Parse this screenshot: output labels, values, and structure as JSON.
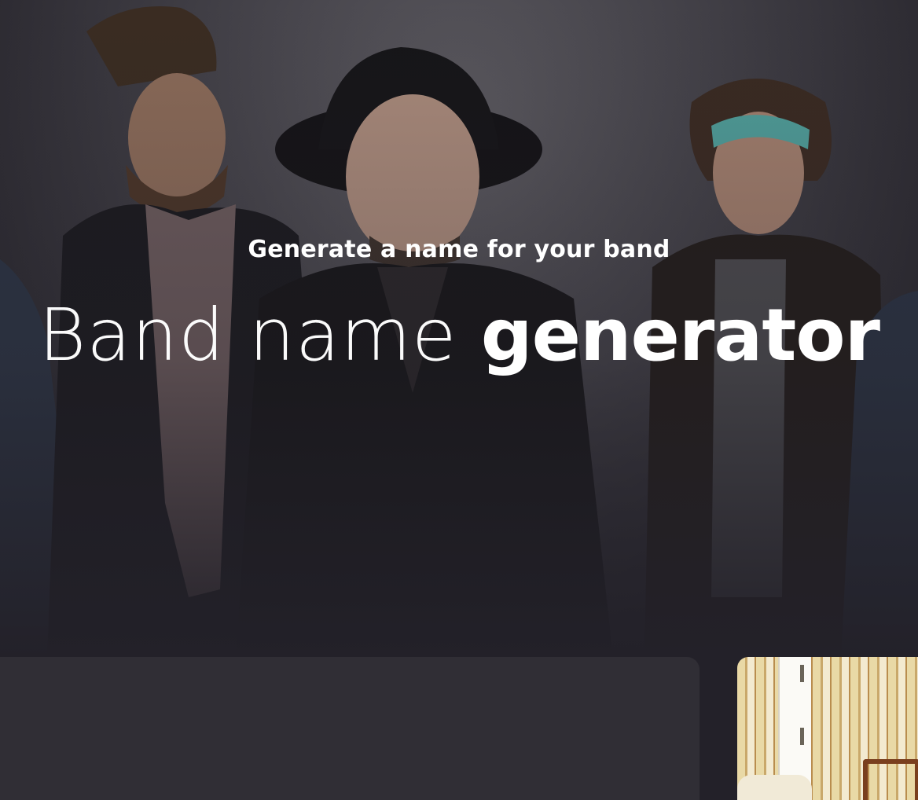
{
  "hero": {
    "subtitle": "Generate a name for your band",
    "title_light": "Band name ",
    "title_bold": "generator"
  },
  "colors": {
    "background": "#232129",
    "card": "#302e35",
    "text": "#ffffff"
  },
  "icons": {
    "hero_image": "band-photo",
    "ad_image": "room-photo"
  }
}
